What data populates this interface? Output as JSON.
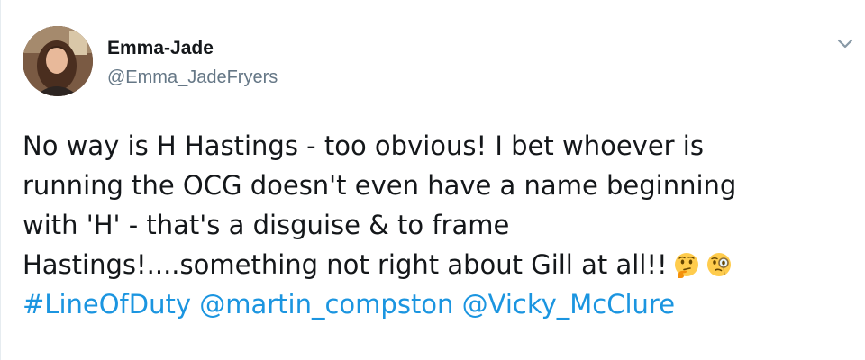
{
  "tweet": {
    "author": {
      "display_name": "Emma-Jade",
      "handle": "@Emma_JadeFryers"
    },
    "text_lines": [
      "No way is H Hastings - too obvious! I bet whoever is",
      "running the OCG  doesn't even have a name beginning",
      "with 'H' - that's a disguise & to frame",
      "Hastings!....something not right about Gill at all!!"
    ],
    "emojis": [
      "thinking-face-icon",
      "face-with-monocle-icon"
    ],
    "hashtag": "#LineOfDuty",
    "mentions": [
      "@martin_compston",
      "@Vicky_McClure"
    ]
  },
  "colors": {
    "link": "#1b95e0",
    "text": "#14171a",
    "secondary": "#657786"
  },
  "icons": {
    "menu": "chevron-down-icon",
    "avatar": "avatar"
  }
}
